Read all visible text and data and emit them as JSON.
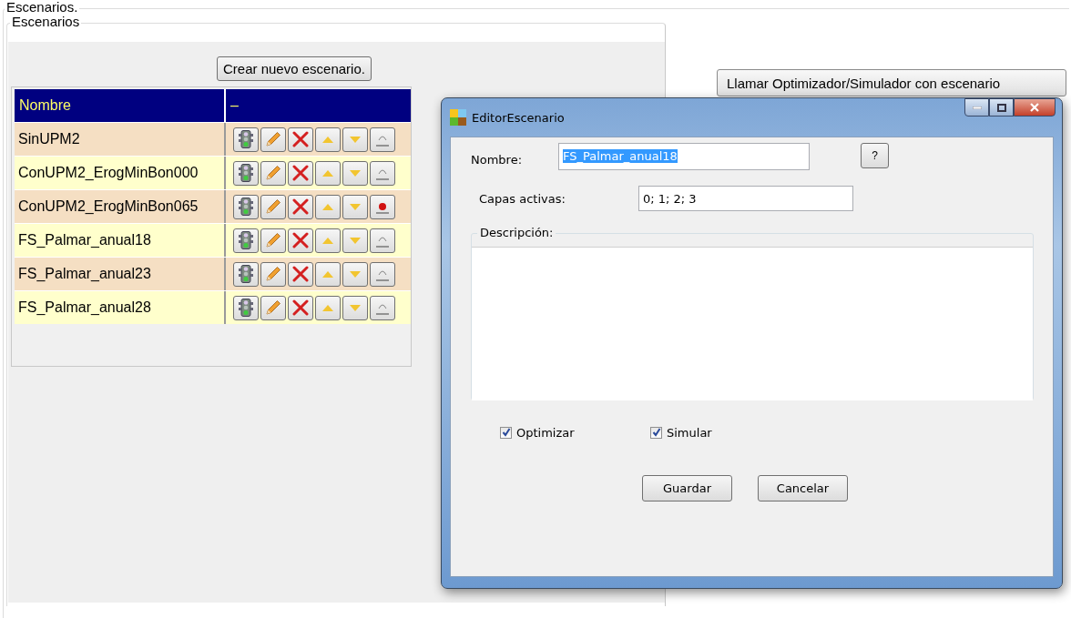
{
  "frame": {
    "legend": "Escenarios."
  },
  "scenarios_panel": {
    "legend": "Escenarios",
    "create_button": "Crear nuevo escenario.",
    "table": {
      "columns": [
        "Nombre",
        "–"
      ],
      "rows": [
        {
          "name": "SinUPM2",
          "marked": false
        },
        {
          "name": "ConUPM2_ErogMinBon000",
          "marked": false
        },
        {
          "name": "ConUPM2_ErogMinBon065",
          "marked": true
        },
        {
          "name": "FS_Palmar_anual18",
          "marked": false
        },
        {
          "name": "FS_Palmar_anual23",
          "marked": false
        },
        {
          "name": "FS_Palmar_anual28",
          "marked": false
        }
      ]
    }
  },
  "run_button": "Llamar Optimizador/Simulador con escenario",
  "dialog": {
    "title": "EditorEscenario",
    "name_label": "Nombre:",
    "name_value": "FS_Palmar_anual18",
    "help_button": "?",
    "layers_label": "Capas activas:",
    "layers_value": "0; 1; 2; 3",
    "description_legend": "Descripción:",
    "checkboxes": [
      {
        "label": "Optimizar",
        "checked": true
      },
      {
        "label": "Simular",
        "checked": true
      }
    ],
    "buttons": [
      "Guardar",
      "Cancelar"
    ]
  }
}
